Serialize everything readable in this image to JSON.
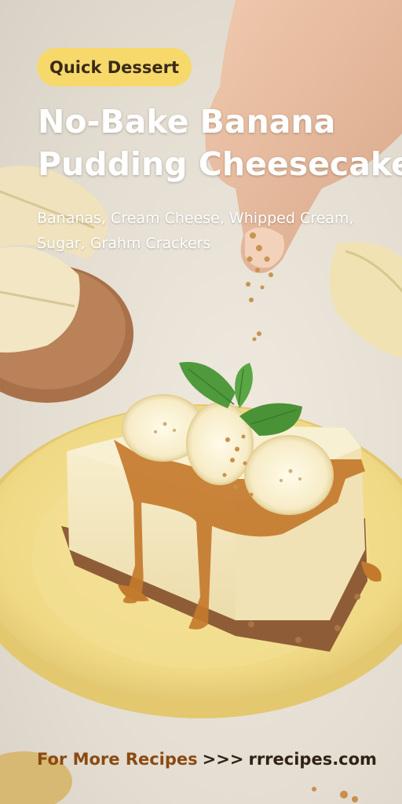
{
  "badge": {
    "label": "Quick Dessert"
  },
  "title": {
    "line1": "No-Bake Banana",
    "line2": "Pudding Cheesecake"
  },
  "ingredients": {
    "line1": "Bananas, Cream Cheese, Whipped Cream,",
    "line2": "Sugar, Grahm Crackers"
  },
  "footer": {
    "label": "For More Recipes",
    "arrows": ">>>",
    "site": "rrrecipes.com"
  },
  "colors": {
    "badge_bg": "#f6d96a",
    "plate": "#f1dc8a",
    "cheesecake": "#f4e9c6",
    "caramel": "#c77a2c",
    "crust": "#8a5a35",
    "mint": "#4f9a3c",
    "banana": "#fbf3d6",
    "footer_accent": "#8a4a12"
  }
}
